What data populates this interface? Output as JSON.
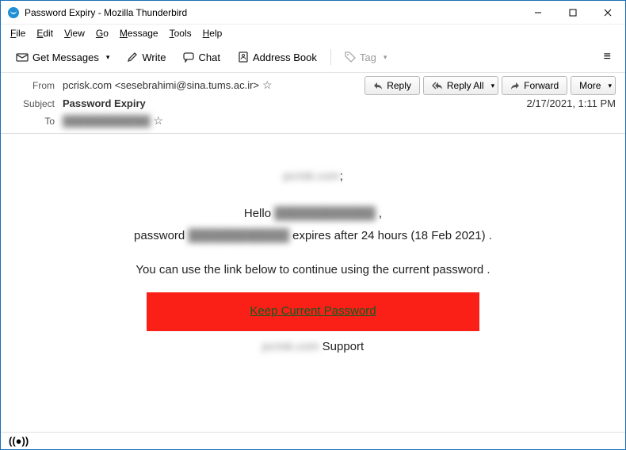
{
  "window": {
    "title": "Password Expiry - Mozilla Thunderbird"
  },
  "menubar": [
    "File",
    "Edit",
    "View",
    "Go",
    "Message",
    "Tools",
    "Help"
  ],
  "toolbar": {
    "get_messages": "Get Messages",
    "write": "Write",
    "chat": "Chat",
    "address_book": "Address Book",
    "tag": "Tag"
  },
  "actions": {
    "reply": "Reply",
    "reply_all": "Reply All",
    "forward": "Forward",
    "more": "More"
  },
  "headers": {
    "from_label": "From",
    "from_value": "pcrisk.com <sesebrahimi@sina.tums.ac.ir>",
    "subject_label": "Subject",
    "subject_value": "Password Expiry",
    "to_label": "To",
    "to_value": "████████████",
    "date": "2/17/2021, 1:11 PM"
  },
  "body": {
    "line1_redacted": "pcrisk.com",
    "line1_suffix": ";",
    "line2_prefix": "Hello ",
    "line2_redacted": "████████████",
    "line2_suffix": " ,",
    "line3_prefix": "password ",
    "line3_redacted": "████████████",
    "line3_suffix": " expires after 24 hours (18 Feb 2021) .",
    "line4": "You can use the link below to continue using the current password .",
    "button": "Keep Current Password",
    "support_redacted": "pcrisk.com",
    "support_suffix": " Support"
  }
}
